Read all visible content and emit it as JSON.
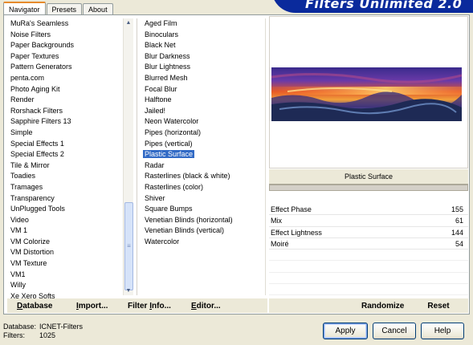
{
  "tabs": [
    {
      "label": "Navigator",
      "active": true
    },
    {
      "label": "Presets",
      "active": false
    },
    {
      "label": "About",
      "active": false
    }
  ],
  "banner_title": "Filters Unlimited 2.0",
  "categories": [
    "MuRa's Seamless",
    "Noise Filters",
    "Paper Backgrounds",
    "Paper Textures",
    "Pattern Generators",
    "penta.com",
    "Photo Aging Kit",
    "Render",
    "Rorshack Filters",
    "Sapphire Filters 13",
    "Simple",
    "Special Effects 1",
    "Special Effects 2",
    "Tile & Mirror",
    "Toadies",
    "Tramages",
    "Transparency",
    "UnPlugged Tools",
    "Video",
    "VM 1",
    "VM Colorize",
    "VM Distortion",
    "VM Texture",
    "VM1",
    "Willy",
    "Xe Xero Softs"
  ],
  "filters": [
    "Aged Film",
    "Binoculars",
    "Black Net",
    "Blur Darkness",
    "Blur Lightness",
    "Blurred Mesh",
    "Focal Blur",
    "Halftone",
    "Jailed!",
    "Neon Watercolor",
    "Pipes (horizontal)",
    "Pipes (vertical)",
    "Plastic Surface",
    "Radar",
    "Rasterlines (black & white)",
    "Rasterlines (color)",
    "Shiver",
    "Square Bumps",
    "Venetian Blinds (horizontal)",
    "Venetian Blinds (vertical)",
    "Watercolor"
  ],
  "selected_filter": "Plastic Surface",
  "current_filter_label": "Plastic Surface",
  "params": [
    {
      "label": "Effect Phase",
      "value": "155"
    },
    {
      "label": "Mix",
      "value": "61"
    },
    {
      "label": "Effect Lightness",
      "value": "144"
    },
    {
      "label": "Moiré",
      "value": "54"
    }
  ],
  "toolbar": {
    "database": "Database",
    "import": "Import...",
    "filter_info": "Filter Info...",
    "editor": "Editor...",
    "randomize": "Randomize",
    "reset": "Reset"
  },
  "footer": {
    "db_key": "Database:",
    "db_value": "ICNET-Filters",
    "filters_key": "Filters:",
    "filters_value": "1025"
  },
  "buttons": {
    "apply": "Apply",
    "cancel": "Cancel",
    "help": "Help"
  },
  "icons": {
    "scroll_up": "up-arrow-icon",
    "scroll_down": "down-arrow-icon"
  }
}
